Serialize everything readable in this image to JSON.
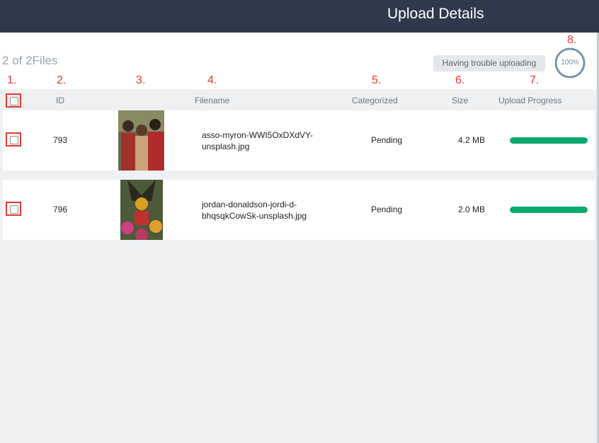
{
  "header": {
    "title": "Upload Details"
  },
  "summary": {
    "file_count": "2 of 2Files"
  },
  "trouble_button": {
    "label": "Having trouble uploading"
  },
  "overall_progress": {
    "label": "100%",
    "value": 1.0
  },
  "annotations": [
    "1.",
    "2.",
    "3.",
    "4.",
    "5.",
    "6.",
    "7.",
    "8."
  ],
  "table": {
    "columns": {
      "id": "ID",
      "filename": "Filename",
      "categorized": "Categorized",
      "size": "Size",
      "upload_progress": "Upload Progress"
    },
    "rows": [
      {
        "id": "793",
        "filename_line1": "asso-myron-WWI5OxDXdVY-",
        "filename_line2": "unsplash.jpg",
        "status": "Pending",
        "size": "4.2 MB",
        "progress": 1.0
      },
      {
        "id": "796",
        "filename_line1": "jordan-donaldson-jordi-d-",
        "filename_line2": "bhqsqkCowSk-unsplash.jpg",
        "status": "Pending",
        "size": "2.0 MB",
        "progress": 1.0
      }
    ]
  },
  "colors": {
    "header_bg": "#2e3a4b",
    "progress_fill": "#0aa96e",
    "annotation": "#e53935",
    "circle_ring": "#6f8fa8"
  }
}
